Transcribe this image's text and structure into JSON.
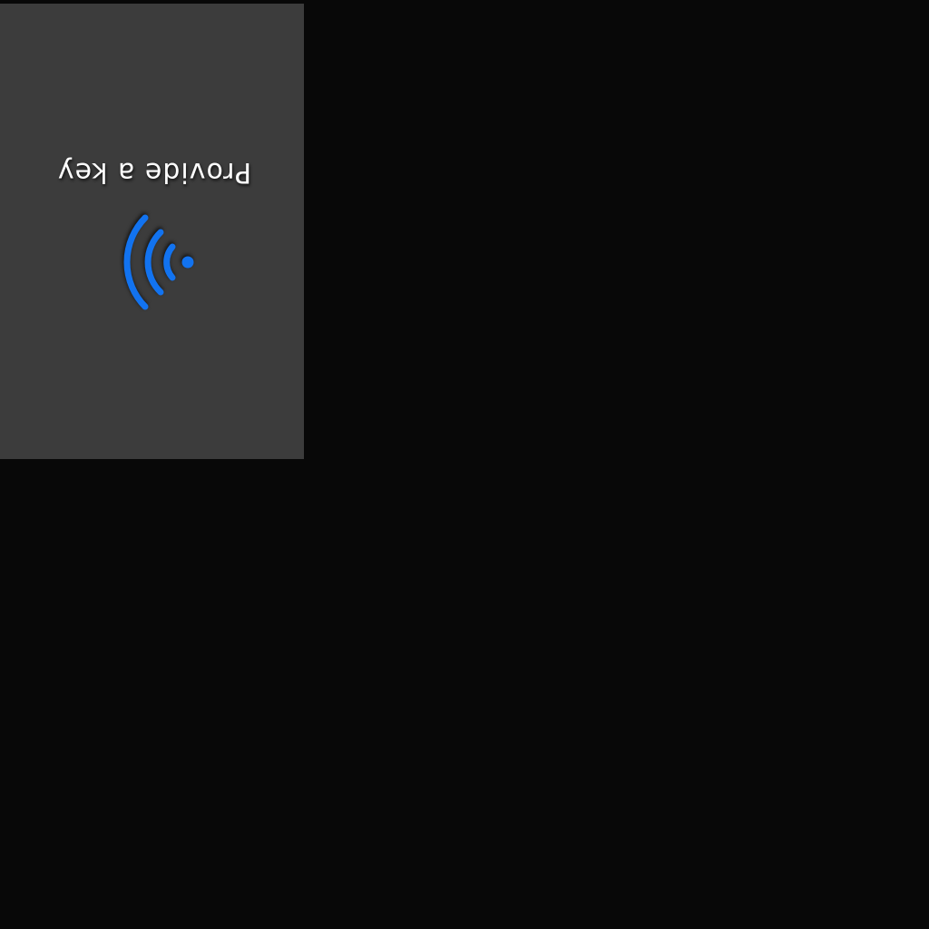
{
  "prompt": {
    "text": "Provide a key"
  },
  "icons": {
    "contactless": "nfc-signal-icon"
  },
  "colors": {
    "background": "#080808",
    "panel": "#3c3c3c",
    "text": "#ffffff",
    "accent": "#1273f0"
  }
}
